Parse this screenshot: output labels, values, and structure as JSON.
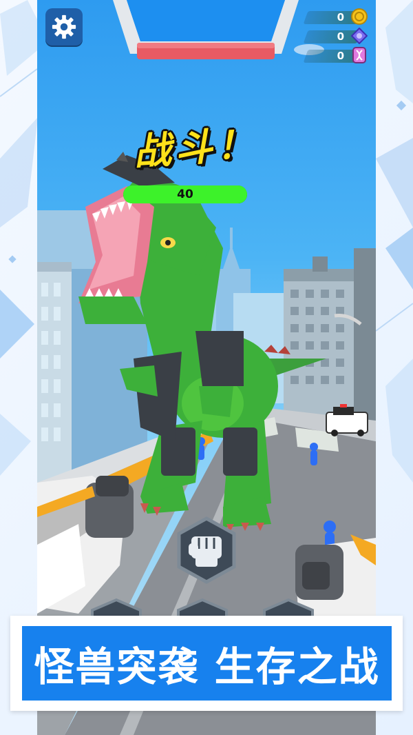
{
  "hud": {
    "settings_icon": "gear-icon",
    "currencies": [
      {
        "name": "coin",
        "value": "0",
        "icon": "coin-icon",
        "color": "#f5c21b"
      },
      {
        "name": "gem",
        "value": "0",
        "icon": "gem-icon",
        "color": "#7b6cf0"
      },
      {
        "name": "dna",
        "value": "0",
        "icon": "dna-icon",
        "color": "#e07adf"
      }
    ]
  },
  "battle": {
    "title": "战斗！",
    "boss_hp": "40",
    "boss_hp_fraction": 1.0
  },
  "controls": {
    "attack_icon": "fist-icon"
  },
  "banner": {
    "text": "怪兽突袭 生存之战"
  },
  "colors": {
    "accent_blue": "#1781ee",
    "title_yellow": "#ffe21a",
    "hp_green": "#22e014",
    "settings_blue": "#1f5fa8"
  }
}
